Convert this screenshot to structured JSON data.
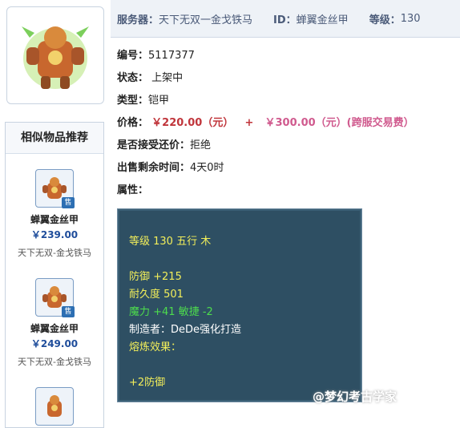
{
  "header": {
    "server_label": "服务器：",
    "server_value": "天下无双一金戈铁马",
    "id_label": "ID：",
    "id_value": "蝉翼金丝甲",
    "level_label": "等级：",
    "level_value": "130"
  },
  "info": {
    "number_label": "编号：",
    "number_value": "5117377",
    "status_label": "状态：",
    "status_value": "上架中",
    "type_label": "类型：",
    "type_value": "铠甲",
    "price_label": "价格：",
    "price_value": "￥220.00（元）",
    "price_plus": "+",
    "fee_value": "￥300.00（元）(跨服交易费）",
    "counter_label": "是否接受还价：",
    "counter_value": "拒绝",
    "time_label": "出售剩余时间：",
    "time_value": "4天0时",
    "attr_label": "属性："
  },
  "attributes": {
    "line1": "等级 130 五行 木",
    "line2": "防御 +215",
    "line3": "耐久度 501",
    "line4": "魔力 +41 敏捷 -2",
    "line5": "制造者：DeDe强化打造",
    "line6": "熔炼效果：",
    "line7": "+2防御"
  },
  "similar": {
    "title": "相似物品推荐",
    "sell_tag": "售",
    "items": [
      {
        "name": "蝉翼金丝甲",
        "price": "￥239.00",
        "server": "天下无双-金戈铁马"
      },
      {
        "name": "蝉翼金丝甲",
        "price": "￥249.00",
        "server": "天下无双-金戈铁马"
      }
    ]
  },
  "watermark": "@梦幻考古学家",
  "colors": {
    "accent_blue": "#1f4d9b",
    "price_red": "#c0353b",
    "fee_pink": "#d05a8e",
    "attr_bg": "#2e4f63",
    "attr_yellow": "#f2ee5a",
    "attr_green": "#4ddc4d"
  }
}
